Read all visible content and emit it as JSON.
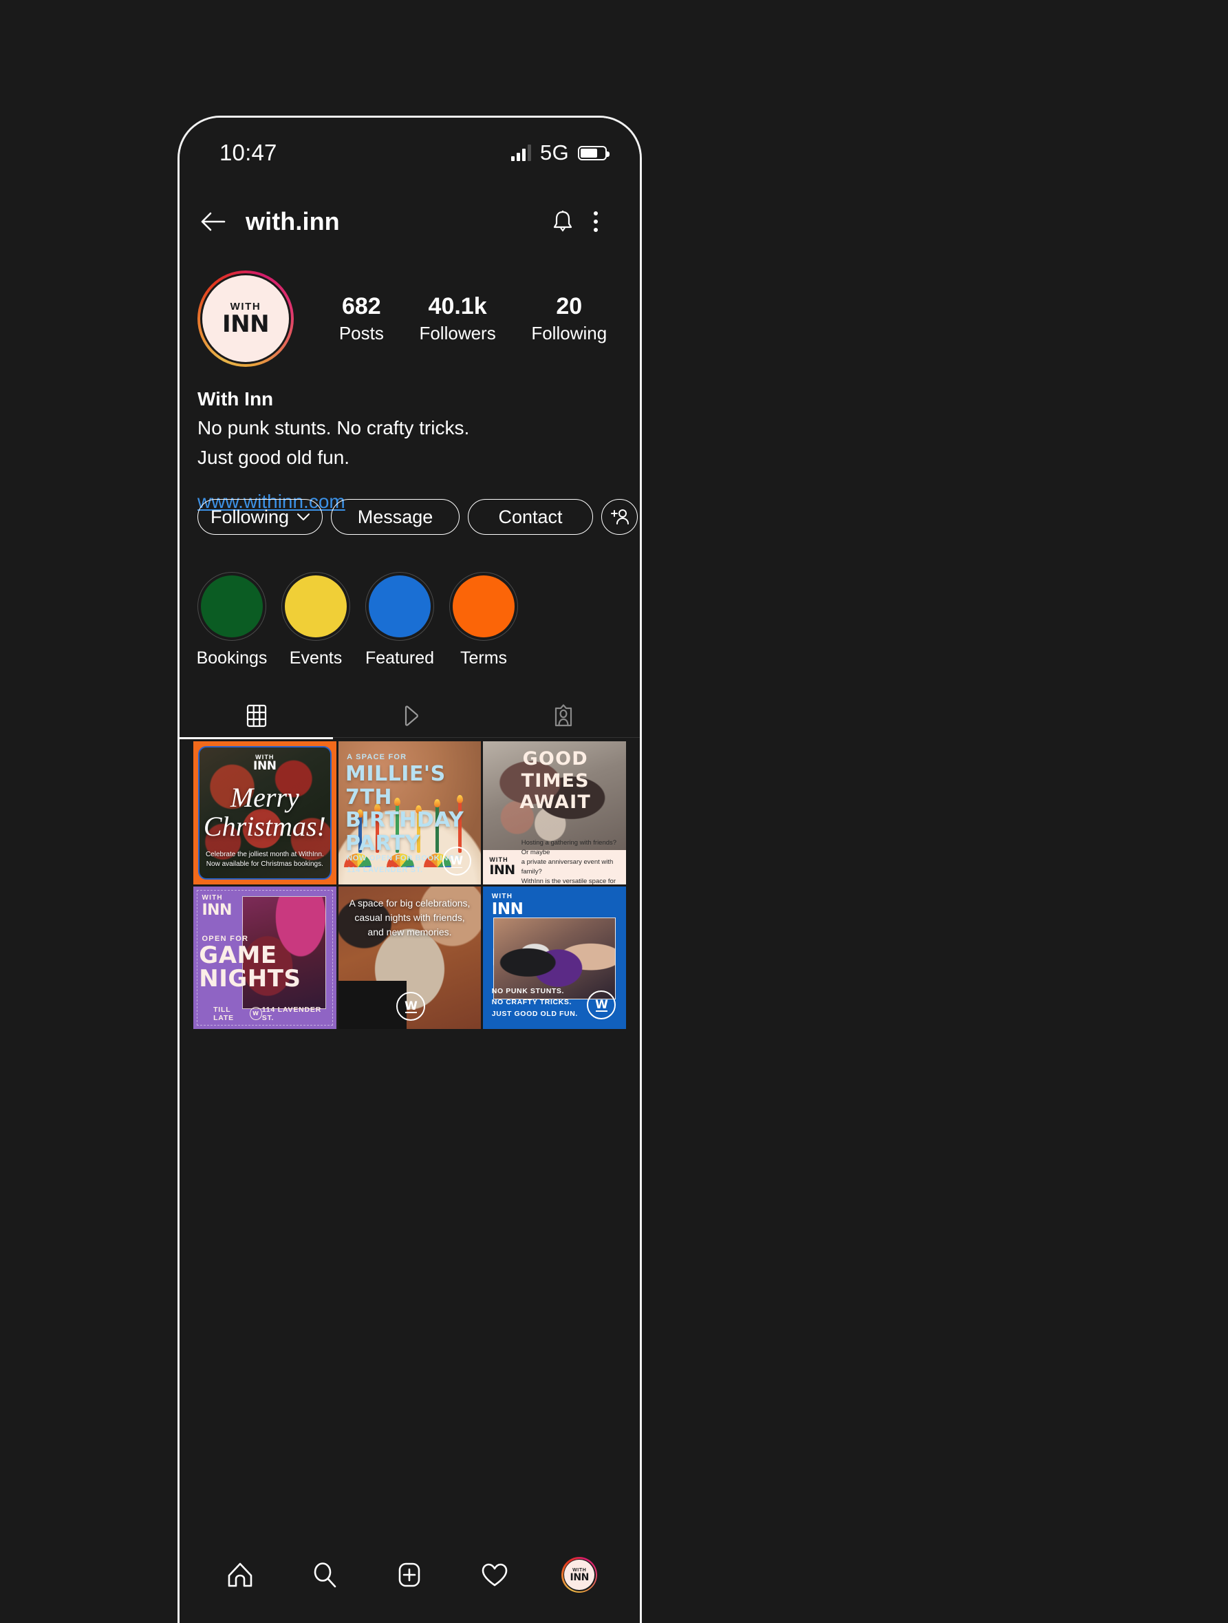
{
  "status_bar": {
    "time": "10:47",
    "network": "5G",
    "signal_bars_filled": 3,
    "signal_bars_total": 4,
    "battery_percent": 70
  },
  "top_nav": {
    "back_icon": "back-arrow-icon",
    "username": "with.inn",
    "notification_icon": "bell-icon",
    "more_icon": "three-dots-icon"
  },
  "profile": {
    "avatar": {
      "logo_top": "WITH",
      "logo_bottom": "INN",
      "ring_colors": [
        "#e8b54a",
        "#e8762c",
        "#e1341e",
        "#d31c6a"
      ],
      "background": "#fcebe6"
    },
    "stats": [
      {
        "value": "682",
        "label": "Posts"
      },
      {
        "value": "40.1k",
        "label": "Followers"
      },
      {
        "value": "20",
        "label": "Following"
      }
    ],
    "display_name": "With Inn",
    "bio_line_1": "No punk stunts. No crafty tricks.",
    "bio_line_2": "Just good old fun.",
    "website": "www.withinn.com",
    "website_color": "#3c91e6"
  },
  "actions": {
    "following_label": "Following",
    "following_chevron": "chevron-down-icon",
    "message_label": "Message",
    "contact_label": "Contact",
    "add_person_icon": "add-person-icon"
  },
  "highlights": [
    {
      "label": "Bookings",
      "color": "#0b5c23"
    },
    {
      "label": "Events",
      "color": "#f0cf37"
    },
    {
      "label": "Featured",
      "color": "#1a6fd4"
    },
    {
      "label": "Terms",
      "color": "#fb6508"
    }
  ],
  "tabs": [
    {
      "name": "grid-tab",
      "icon": "grid-icon",
      "active": true
    },
    {
      "name": "reels-tab",
      "icon": "play-triangle-icon",
      "active": false
    },
    {
      "name": "tagged-tab",
      "icon": "tagged-person-icon",
      "active": false
    }
  ],
  "posts": [
    {
      "id": "post-merry-christmas",
      "logo_top": "WITH",
      "logo_bottom": "INN",
      "title_line_1": "Merry",
      "title_line_2": "Christmas!",
      "caption_line_1": "Celebrate the jolliest month at WithInn.",
      "caption_line_2": "Now available for Christmas bookings.",
      "frame_color": "#f26a1b"
    },
    {
      "id": "post-millies-birthday",
      "superhead": "A SPACE FOR",
      "title": "MILLIE'S 7TH BIRTHDAY PARTY",
      "footer_line_1": "NOW OPEN FOR BOOKINGS",
      "footer_line_2": "114 LAVENDER ST.",
      "badge": "W"
    },
    {
      "id": "post-good-times-await",
      "title_line_1": "GOOD TIMES",
      "title_line_2": "AWAIT",
      "logo_top": "WITH",
      "logo_bottom": "INN",
      "body_line_1": "Hosting a gathering with friends? Or maybe",
      "body_line_2": "a private anniversary event with family?",
      "body_line_3": "WithInn is the versatile space for you."
    },
    {
      "id": "post-game-nights",
      "logo_top": "WITH",
      "logo_bottom": "INN",
      "superhead": "OPEN FOR",
      "title_line_1": "GAME",
      "title_line_2": "NIGHTS",
      "footer_left": "TILL LATE",
      "footer_right": "114 LAVENDER ST.",
      "badge": "W"
    },
    {
      "id": "post-big-celebrations",
      "text_line_1": "A space for big celebrations,",
      "text_line_2": "casual nights with friends,",
      "text_line_3": "and new memories.",
      "badge": "W"
    },
    {
      "id": "post-no-punk-stunts",
      "logo_top": "WITH",
      "logo_bottom": "INN",
      "footer_line_1": "NO PUNK STUNTS.",
      "footer_line_2": "NO CRAFTY TRICKS.",
      "footer_line_3": "JUST GOOD OLD FUN.",
      "badge": "W"
    }
  ],
  "bottom_nav": [
    {
      "name": "home-tab",
      "icon": "home-icon"
    },
    {
      "name": "search-tab",
      "icon": "search-icon"
    },
    {
      "name": "create-tab",
      "icon": "plus-square-icon"
    },
    {
      "name": "activity-tab",
      "icon": "heart-icon"
    },
    {
      "name": "profile-tab",
      "icon": "profile-avatar",
      "logo_top": "WITH",
      "logo_bottom": "INN"
    }
  ]
}
